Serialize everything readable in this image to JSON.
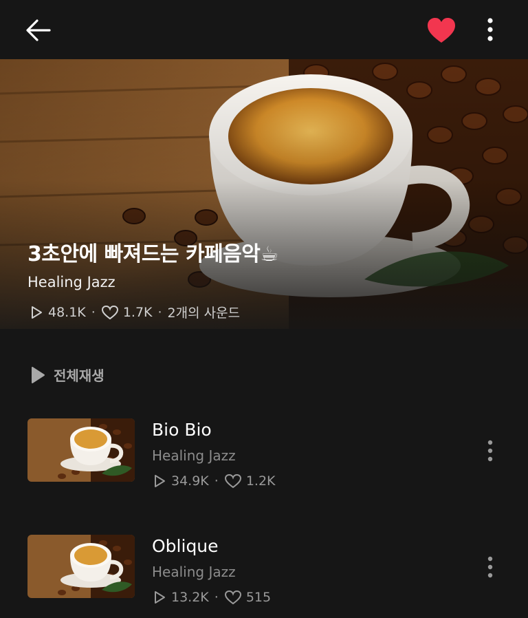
{
  "topbar": {
    "back_icon": "arrow-left-icon",
    "like_icon": "heart-filled-icon",
    "more_icon": "more-vertical-icon",
    "like_color": "#f2364f"
  },
  "playlist": {
    "title": "3초안에 빠져드는 카페음악☕",
    "artist": "Healing Jazz",
    "plays": "48.1K",
    "likes": "1.7K",
    "sound_count": "2개의 사운드",
    "separator": "·"
  },
  "play_all": {
    "label": "전체재생",
    "icon": "play-icon"
  },
  "tracks": [
    {
      "title": "Bio Bio",
      "artist": "Healing Jazz",
      "plays": "34.9K",
      "likes": "1.2K"
    },
    {
      "title": "Oblique",
      "artist": "Healing Jazz",
      "plays": "13.2K",
      "likes": "515"
    }
  ]
}
